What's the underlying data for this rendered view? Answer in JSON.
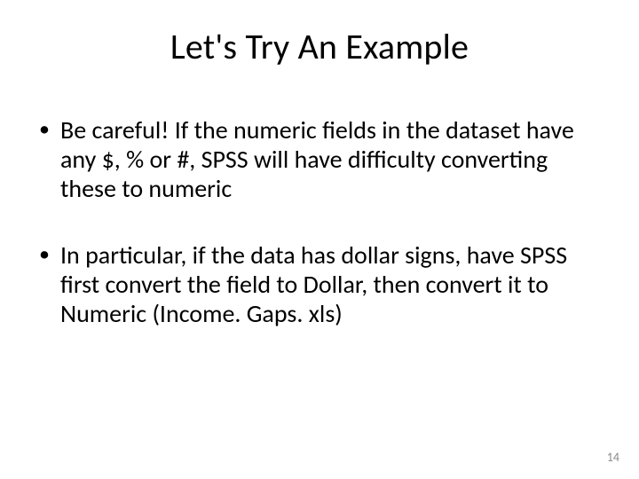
{
  "slide": {
    "title": "Let's Try An Example",
    "bullets": [
      "Be careful!  If the numeric fields in the dataset have any $, % or #, SPSS will have difficulty converting these to numeric",
      "In particular, if the data has dollar signs, have SPSS first convert the field to Dollar, then convert it to Numeric (Income. Gaps. xls)"
    ],
    "page_number": "14"
  }
}
